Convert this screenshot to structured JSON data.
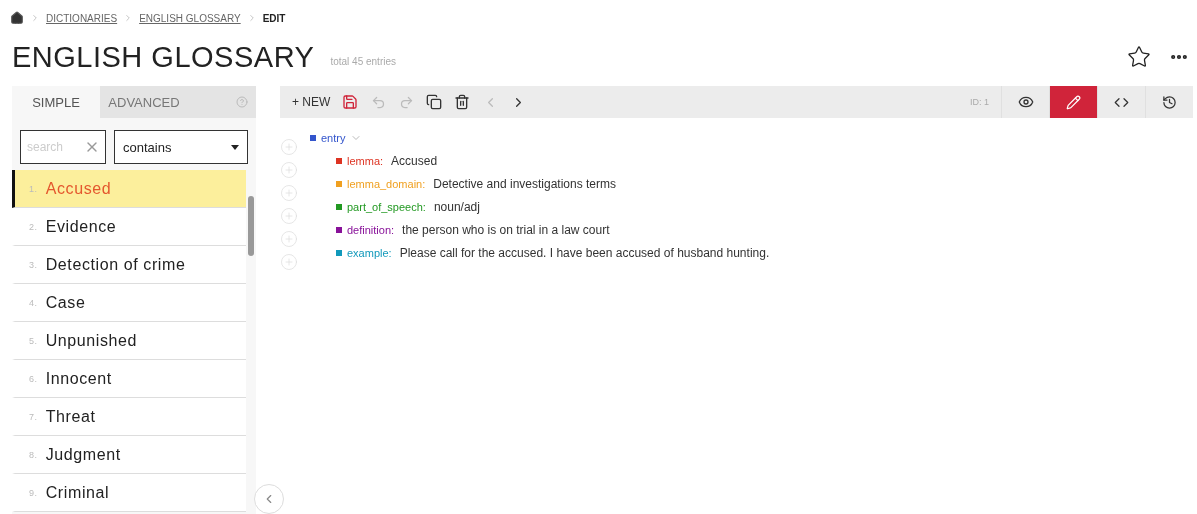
{
  "breadcrumb": [
    {
      "label": "DICTIONARIES",
      "link": true
    },
    {
      "label": "ENGLISH GLOSSARY",
      "link": true
    },
    {
      "label": "EDIT",
      "link": false
    }
  ],
  "title": "ENGLISH GLOSSARY",
  "subtitle": "total 45 entries",
  "tabs": [
    {
      "label": "SIMPLE",
      "selected": true
    },
    {
      "label": "ADVANCED",
      "selected": false
    }
  ],
  "search": {
    "placeholder": "search",
    "mode": "contains"
  },
  "entries": [
    {
      "number": "1.",
      "label": "Accused",
      "selected": true
    },
    {
      "number": "2.",
      "label": "Evidence",
      "selected": false
    },
    {
      "number": "3.",
      "label": "Detection of crime",
      "selected": false
    },
    {
      "number": "4.",
      "label": "Case",
      "selected": false
    },
    {
      "number": "5.",
      "label": "Unpunished",
      "selected": false
    },
    {
      "number": "6.",
      "label": "Innocent",
      "selected": false
    },
    {
      "number": "7.",
      "label": "Threat",
      "selected": false
    },
    {
      "number": "8.",
      "label": "Judgment",
      "selected": false
    },
    {
      "number": "9.",
      "label": "Criminal",
      "selected": false
    }
  ],
  "toolbar": {
    "new_label": "+ NEW",
    "id_label": "ID: 1",
    "views": [
      {
        "kind": "view",
        "selected": false
      },
      {
        "kind": "edit",
        "selected": true
      },
      {
        "kind": "code",
        "selected": false
      },
      {
        "kind": "history",
        "selected": false
      }
    ]
  },
  "document": {
    "root": {
      "name": "entry",
      "color": "#3355cc"
    },
    "fields": [
      {
        "name": "lemma:",
        "value": "Accused",
        "color": "#dd3322"
      },
      {
        "name": "lemma_domain:",
        "value": "Detective and investigations terms",
        "color": "#f0a020"
      },
      {
        "name": "part_of_speech:",
        "value": "noun/adj",
        "color": "#229922"
      },
      {
        "name": "definition:",
        "value": "the person who is on trial in a law court",
        "color": "#881199"
      },
      {
        "name": "example:",
        "value": "Please call for the accused. I have been accused of husband hunting.",
        "color": "#1199bb"
      }
    ]
  }
}
